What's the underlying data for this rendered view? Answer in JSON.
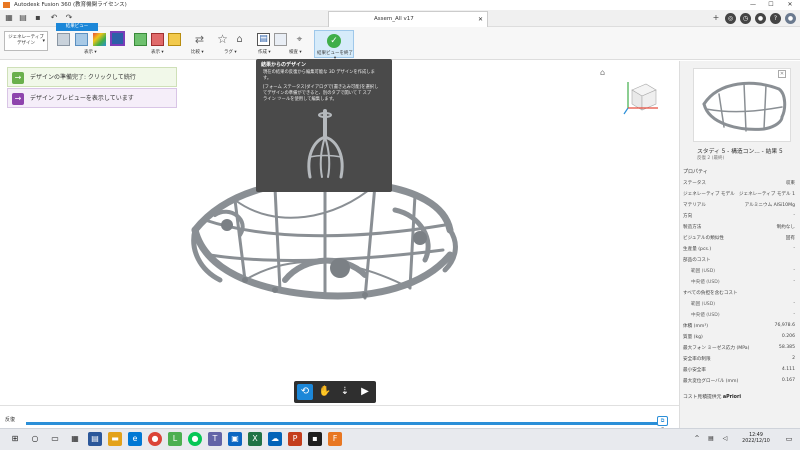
{
  "window": {
    "title": "Autodesk Fusion 360 (教育機関ライセンス)",
    "minimize": "—",
    "maximize": "☐",
    "close": "✕"
  },
  "document_tab": {
    "label": "Assem_All v17",
    "close": "✕"
  },
  "tabbar_icons": [
    "grid-icon",
    "file-icon",
    "save-icon",
    "undo-icon",
    "redo-icon",
    "add-tab-icon",
    "extensions-icon",
    "clock-icon",
    "bell-icon",
    "help-icon",
    "user-avatar"
  ],
  "workspace": {
    "line1": "ジェネレーティブ",
    "line2": "デザイン",
    "chevron": "▾"
  },
  "ribbon": {
    "active_tab": "結果ビュー",
    "groups": [
      {
        "label": "表示 ▾"
      },
      {
        "label": "表示 ▾"
      },
      {
        "label": "比較 ▾"
      },
      {
        "label": "ラグ ▾"
      },
      {
        "label": "作成 ▾"
      },
      {
        "label": "検査 ▾"
      },
      {
        "label": "結果ビューを終了 ▾"
      }
    ]
  },
  "notices": [
    {
      "text": "デザインの準備完了: クリックして続行",
      "icon": "→",
      "color": "#6ab04c"
    },
    {
      "text": "デザイン プレビューを表示しています",
      "icon": "→",
      "color": "#8e44ad"
    }
  ],
  "tooltip": {
    "title": "結果からのデザイン",
    "body": [
      "現在の結果の反復から編集可能な 3D デザインを作成しま",
      "す。",
      "[フォーム ステータス]ダイアログで[書き込み可能]を選択し",
      "てデザインの準備ができると、別のタブで開いて T スプ",
      "ライン ツールを使用して編集します。"
    ]
  },
  "navbar": {
    "tools": [
      "orbit-icon",
      "pan-icon",
      "look-at-icon",
      "camera-icon"
    ]
  },
  "timeline": {
    "label": "反復",
    "handle_icon": "⧉",
    "iteration": "2"
  },
  "right_panel": {
    "study_title": "スタディ 5 - 構造コン... - 結果 5",
    "study_subtitle": "反復 2 (最終)",
    "properties_header": "プロパティ",
    "rows": [
      {
        "k": "ステータス",
        "v": "収束",
        "sub": false
      },
      {
        "k": "ジェネレーティブ モデル",
        "v": "ジェネレーティブ モデル 1",
        "sub": false
      },
      {
        "k": "マテリアル",
        "v": "アルミニウム AlSi10Mg",
        "sub": false
      },
      {
        "k": "方向",
        "v": "-",
        "sub": false
      },
      {
        "k": "製造方法",
        "v": "制約なし",
        "sub": false
      },
      {
        "k": "ビジュアルの類似性",
        "v": "固有",
        "sub": false
      },
      {
        "k": "生産量 (pcs.)",
        "v": "-",
        "sub": false
      },
      {
        "k": "部品のコスト",
        "v": "",
        "sub": false
      },
      {
        "k": "範囲 (USD)",
        "v": "-",
        "sub": true
      },
      {
        "k": "中央値 (USD)",
        "v": "-",
        "sub": true
      },
      {
        "k": "すべての負担を含むコスト",
        "v": "",
        "sub": false
      },
      {
        "k": "範囲 (USD)",
        "v": "-",
        "sub": true
      },
      {
        "k": "中央値 (USD)",
        "v": "-",
        "sub": true
      },
      {
        "k": "体積 (mm³)",
        "v": "76,978.6",
        "sub": false
      },
      {
        "k": "質量 (kg)",
        "v": "0.206",
        "sub": false
      },
      {
        "k": "最大フォン ミーゼス応力 (MPa)",
        "v": "58.385",
        "sub": false
      },
      {
        "k": "安全率の制限",
        "v": "2",
        "sub": false
      },
      {
        "k": "最小安全率",
        "v": "4.111",
        "sub": false
      },
      {
        "k": "最大変位グローバル (mm)",
        "v": "0.167",
        "sub": false
      }
    ],
    "provider_label": "コスト見積提供元",
    "provider_name": "aPriori"
  },
  "taskbar": {
    "time": "12:49",
    "date": "2022/12/10"
  }
}
